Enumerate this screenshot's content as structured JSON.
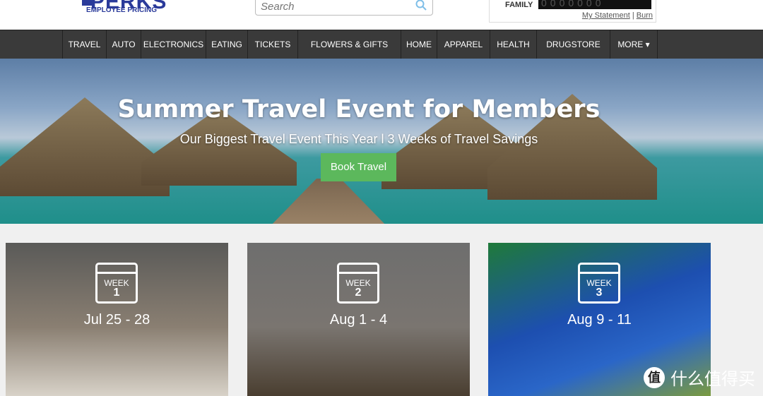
{
  "header": {
    "logo_title": "PERKS",
    "logo_subtitle": "EMPLOYEE PRICING",
    "search_placeholder": "Search",
    "account_label": "FAMILY",
    "counter": "0000000",
    "links": [
      "My Statement",
      "Burn"
    ],
    "link_sep": "|"
  },
  "nav": [
    "TRAVEL",
    "AUTO",
    "ELECTRONICS",
    "EATING",
    "TICKETS",
    "FLOWERS & GIFTS",
    "HOME",
    "APPAREL",
    "HEALTH",
    "DRUGSTORE",
    "MORE ▾"
  ],
  "hero": {
    "title": "Summer Travel Event for Members",
    "subtitle": "Our Biggest Travel Event This Year l 3 Weeks of Travel Savings",
    "button": "Book Travel",
    "button_color": "#5cb85c"
  },
  "weeks": [
    {
      "label": "WEEK",
      "num": "1",
      "dates": "Jul 25 - 28"
    },
    {
      "label": "WEEK",
      "num": "2",
      "dates": "Aug 1 - 4"
    },
    {
      "label": "WEEK",
      "num": "3",
      "dates": "Aug 9 - 11"
    }
  ],
  "watermark": {
    "badge": "值",
    "text": "什么值得买"
  }
}
